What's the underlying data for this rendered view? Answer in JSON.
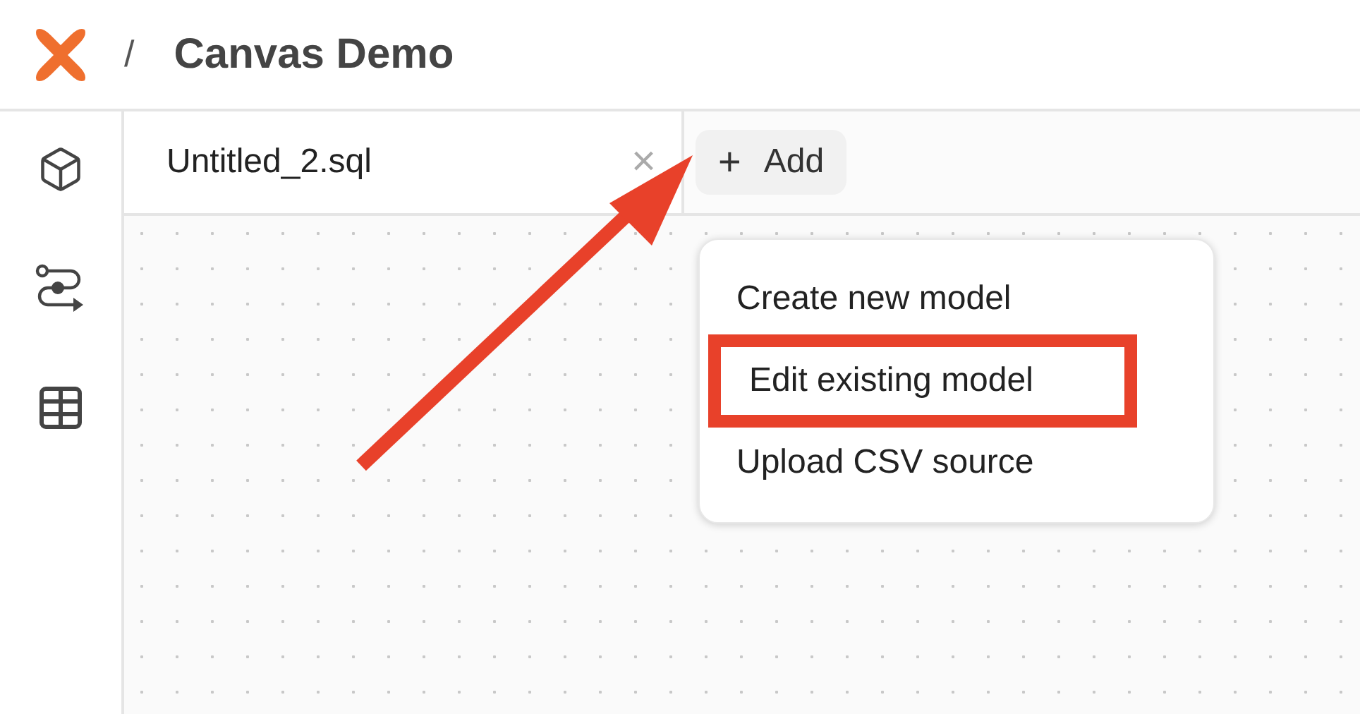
{
  "header": {
    "separator": "/",
    "project": "Canvas Demo"
  },
  "sidebar": {
    "items": [
      {
        "kind": "cube"
      },
      {
        "kind": "flow"
      },
      {
        "kind": "table"
      }
    ]
  },
  "tabs": [
    {
      "label": "Untitled_2.sql",
      "close": "×"
    }
  ],
  "add_button": {
    "icon": "+",
    "label": "Add"
  },
  "menu": {
    "items": [
      {
        "label": "Create new model",
        "highlighted": false
      },
      {
        "label": "Edit existing model",
        "highlighted": true
      },
      {
        "label": "Upload CSV source",
        "highlighted": false
      }
    ]
  }
}
